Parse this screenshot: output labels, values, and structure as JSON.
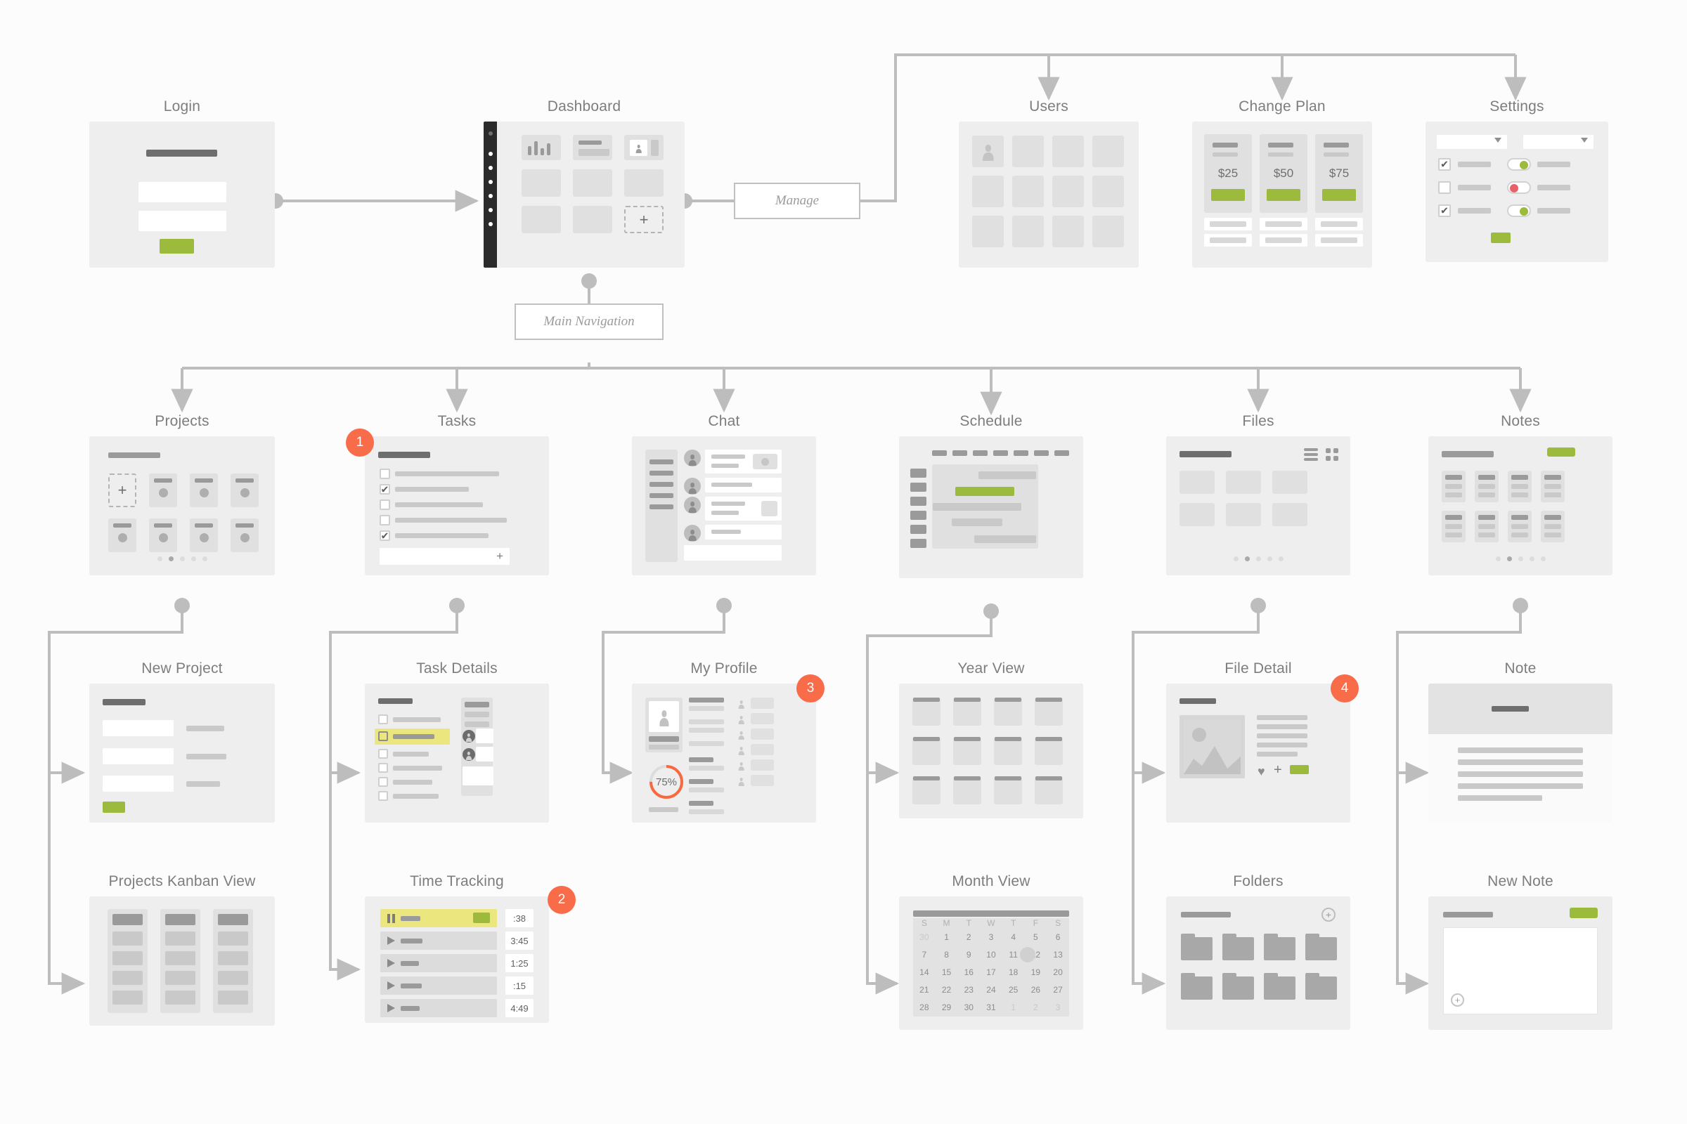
{
  "diagram": {
    "type": "ui-flowchart-sitemap",
    "background": "#fcfcfc",
    "accent_green": "#9cba3b",
    "accent_orange": "#f96c4a",
    "accent_yellow": "#ece67f",
    "accent_red": "#e8616a",
    "connector_color": "#bdbdbd"
  },
  "connectors": {
    "manage_label": "Manage",
    "main_nav_label": "Main Navigation"
  },
  "row1": {
    "login": {
      "title": "Login"
    },
    "dashboard": {
      "title": "Dashboard",
      "add_tile_icon": "plus-icon"
    },
    "users": {
      "title": "Users",
      "avatar_count": 12
    },
    "change_plan": {
      "title": "Change Plan",
      "plans": [
        {
          "price": "$25"
        },
        {
          "price": "$50"
        },
        {
          "price": "$75"
        }
      ]
    },
    "settings": {
      "title": "Settings",
      "checkboxes": [
        true,
        false,
        true
      ],
      "toggles": [
        {
          "on": true,
          "color": "#9cba3b"
        },
        {
          "on": false,
          "color": "#e8616a"
        },
        {
          "on": true,
          "color": "#9cba3b"
        }
      ]
    }
  },
  "row2": {
    "projects": {
      "title": "Projects",
      "badge": "1",
      "tiles": 8,
      "pager_dots": 5,
      "pager_active": 1
    },
    "tasks": {
      "title": "Tasks",
      "items": [
        false,
        true,
        false,
        false,
        true
      ],
      "add_icon": "plus-icon"
    },
    "chat": {
      "title": "Chat",
      "messages": 4
    },
    "schedule": {
      "title": "Schedule",
      "columns": 7,
      "rows": 6
    },
    "files": {
      "title": "Files",
      "view_icons": [
        "list-view-icon",
        "grid-view-icon"
      ],
      "tiles": 6,
      "pager_dots": 5,
      "pager_active": 1
    },
    "notes": {
      "title": "Notes",
      "cards": 8,
      "pager_dots": 5,
      "pager_active": 1
    }
  },
  "row3": {
    "new_project": {
      "title": "New Project",
      "fields": 3,
      "submit_label": ""
    },
    "task_details": {
      "title": "Task Details",
      "items": 6,
      "highlighted_index": 1,
      "assignees": 2
    },
    "my_profile": {
      "title": "My Profile",
      "badge": "3",
      "progress_label": "75%",
      "progress_value": 75,
      "contacts": 6
    },
    "year_view": {
      "title": "Year View",
      "months": 12
    },
    "file_detail": {
      "title": "File Detail",
      "badge": "4",
      "actions": [
        "heart-icon",
        "plus-icon",
        "share-button"
      ]
    },
    "note": {
      "title": "Note"
    }
  },
  "row4": {
    "projects_kanban": {
      "title": "Projects Kanban View",
      "columns": 3,
      "cards_per_column": 4
    },
    "time_tracking": {
      "title": "Time Tracking",
      "badge": "2",
      "rows": [
        {
          "icon": "pause-icon",
          "active": true,
          "time": ":38"
        },
        {
          "icon": "play-icon",
          "active": false,
          "time": "3:45"
        },
        {
          "icon": "play-icon",
          "active": false,
          "time": "1:25"
        },
        {
          "icon": "play-icon",
          "active": false,
          "time": ":15"
        },
        {
          "icon": "play-icon",
          "active": false,
          "time": "4:49"
        }
      ]
    },
    "month_view": {
      "title": "Month View",
      "weekday_headers": [
        "S",
        "M",
        "T",
        "W",
        "T",
        "F",
        "S"
      ],
      "selected_day": "12",
      "weeks": [
        [
          {
            "d": "30",
            "mute": true
          },
          {
            "d": "1"
          },
          {
            "d": "2"
          },
          {
            "d": "3"
          },
          {
            "d": "4"
          },
          {
            "d": "5"
          },
          {
            "d": "6"
          }
        ],
        [
          {
            "d": "7"
          },
          {
            "d": "8"
          },
          {
            "d": "9"
          },
          {
            "d": "10"
          },
          {
            "d": "11"
          },
          {
            "d": "12",
            "sel": true
          },
          {
            "d": "13"
          }
        ],
        [
          {
            "d": "14"
          },
          {
            "d": "15"
          },
          {
            "d": "16"
          },
          {
            "d": "17"
          },
          {
            "d": "18"
          },
          {
            "d": "19"
          },
          {
            "d": "20"
          }
        ],
        [
          {
            "d": "21"
          },
          {
            "d": "22"
          },
          {
            "d": "23"
          },
          {
            "d": "24"
          },
          {
            "d": "25"
          },
          {
            "d": "26"
          },
          {
            "d": "27"
          }
        ],
        [
          {
            "d": "28"
          },
          {
            "d": "29"
          },
          {
            "d": "30"
          },
          {
            "d": "31"
          },
          {
            "d": "1",
            "mute": true
          },
          {
            "d": "2",
            "mute": true
          },
          {
            "d": "3",
            "mute": true
          }
        ]
      ]
    },
    "folders": {
      "title": "Folders",
      "count": 8,
      "add_icon": "plus-circle-icon"
    },
    "new_note": {
      "title": "New Note",
      "add_icon": "plus-circle-icon"
    }
  }
}
